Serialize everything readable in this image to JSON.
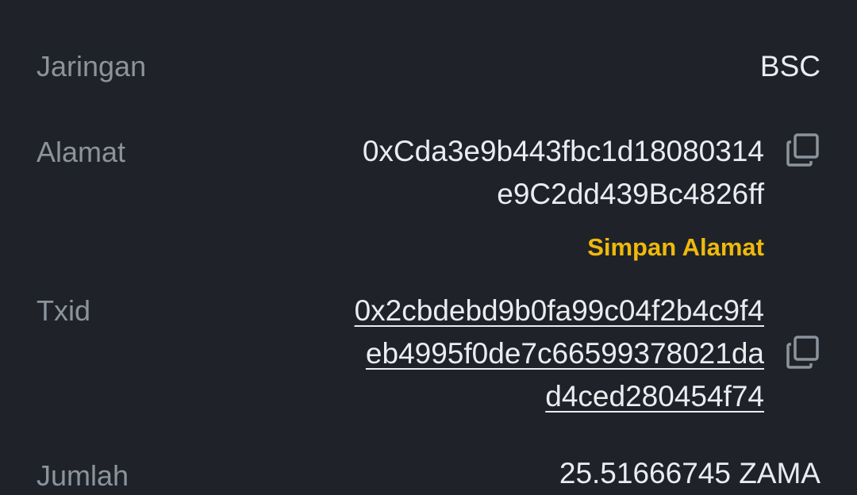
{
  "network": {
    "label": "Jaringan",
    "value": "BSC"
  },
  "address": {
    "label": "Alamat",
    "lines": [
      "0xCda3e9b443fbc1d18080314",
      "e9C2dd439Bc4826ff"
    ],
    "save_label": "Simpan Alamat",
    "copy_icon": "copy-icon"
  },
  "txid": {
    "label": "Txid",
    "lines": [
      "0x2cbdebd9b0fa99c04f2b4c9f4",
      "eb4995f0de7c66599378021da",
      "d4ced280454f74"
    ],
    "copy_icon": "copy-icon"
  },
  "amount": {
    "label": "Jumlah",
    "value": "25.51666745 ZAMA"
  },
  "colors": {
    "background": "#1f2329",
    "label": "#8c939d",
    "value": "#eaecef",
    "accent": "#f0b90b"
  }
}
